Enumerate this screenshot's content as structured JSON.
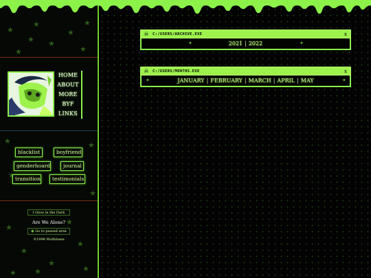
{
  "colors": {
    "accent": "#8cf24a",
    "accent_light": "#9df24c",
    "background": "#030303",
    "text": "#d9ff9e"
  },
  "sidebar": {
    "nav": [
      {
        "label": "HOME"
      },
      {
        "label": "ABOUT"
      },
      {
        "label": "MORE"
      },
      {
        "label": "BYF"
      },
      {
        "label": "LINKS"
      }
    ],
    "tags": [
      {
        "label": "blacklist"
      },
      {
        "label": "boyfriend"
      },
      {
        "label": "genderhoard"
      },
      {
        "label": "journal"
      },
      {
        "label": "transition"
      },
      {
        "label": "testimonials"
      }
    ],
    "badges": {
      "top": "I Glow in the Dark",
      "middle": "Are We Alone?",
      "bottom": "Go to passed area",
      "footer": "©1998 Wolfsbane"
    }
  },
  "panels": [
    {
      "title": "C:/USERS/ARCHIVE.EXE",
      "close": "x",
      "links": [
        "2021",
        "2022"
      ]
    },
    {
      "title": "C:/USERS/MONTHS.EXE",
      "close": "x",
      "links": [
        "JANUARY",
        "FEBRUARY",
        "MARCH",
        "APRIL",
        "MAY"
      ]
    }
  ]
}
